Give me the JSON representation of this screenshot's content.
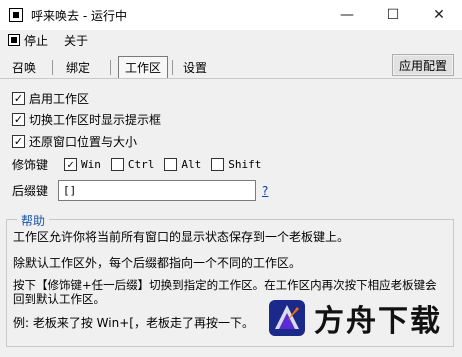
{
  "window": {
    "title": "呼来唤去 - 运行中",
    "minimize_glyph": "—",
    "maximize_glyph": "☐",
    "close_glyph": "✕"
  },
  "menu": {
    "stop_label": "停止",
    "about_label": "关于"
  },
  "tabs": [
    {
      "label": "召唤"
    },
    {
      "label": "绑定"
    },
    {
      "label": "工作区",
      "active": true
    },
    {
      "label": "设置"
    }
  ],
  "apply_button": "应用配置",
  "options": {
    "enable_workspace": {
      "label": "启用工作区",
      "checked": true
    },
    "show_tip_on_switch": {
      "label": "切换工作区时显示提示框",
      "checked": true
    },
    "restore_window_pos": {
      "label": "还原窗口位置与大小",
      "checked": true
    }
  },
  "modifier": {
    "label": "修饰键",
    "keys": [
      {
        "label": "Win",
        "checked": true
      },
      {
        "label": "Ctrl",
        "checked": false
      },
      {
        "label": "Alt",
        "checked": false
      },
      {
        "label": "Shift",
        "checked": false
      }
    ]
  },
  "suffix": {
    "label": "后缀键",
    "value": "[]",
    "help_link": "?"
  },
  "help": {
    "title": "帮助",
    "p1": "工作区允许你将当前所有窗口的显示状态保存到一个老板键上。",
    "p2": "除默认工作区外，每个后缀都指向一个不同的工作区。",
    "p3": "按下【修饰键+任一后缀】切换到指定的工作区。在工作区内再次按下相应老板键会回到默认工作区。",
    "p4": "例: 老板来了按 Win+[，老板走了再按一下。"
  },
  "watermark": {
    "text": "方舟下载"
  },
  "colors": {
    "link": "#0645ad",
    "help_title": "#1a55a8"
  }
}
